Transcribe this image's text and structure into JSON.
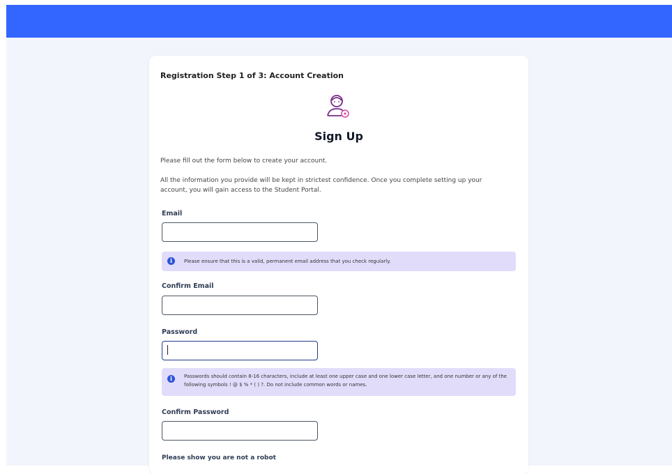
{
  "header": {
    "bar_color": "#3366ff"
  },
  "form": {
    "step_title": "Registration Step 1 of 3: Account Creation",
    "avatar_icon": "user-avatar-icon",
    "heading": "Sign Up",
    "intro": "Please fill out the form below to create your account.",
    "privacy": "All the information you provide will be kept in strictest confidence. Once you complete setting up your account, you will gain access to the Student Portal.",
    "email": {
      "label": "Email",
      "value": ""
    },
    "email_hint": "Please ensure that this is a valid, permanent email address that you check regularly.",
    "confirm_email": {
      "label": "Confirm Email",
      "value": ""
    },
    "password": {
      "label": "Password",
      "value": ""
    },
    "password_hint": "Passwords should contain 8-16 characters, include at least one upper case and one lower case letter, and one number or any of the following symbols ! @ $ % * ( ) ?. Do not include common words or names.",
    "confirm_password": {
      "label": "Confirm Password",
      "value": ""
    },
    "robot_label": "Please show you are not a robot",
    "info_icon": "info-icon",
    "info_color": "#e2dcfb"
  }
}
